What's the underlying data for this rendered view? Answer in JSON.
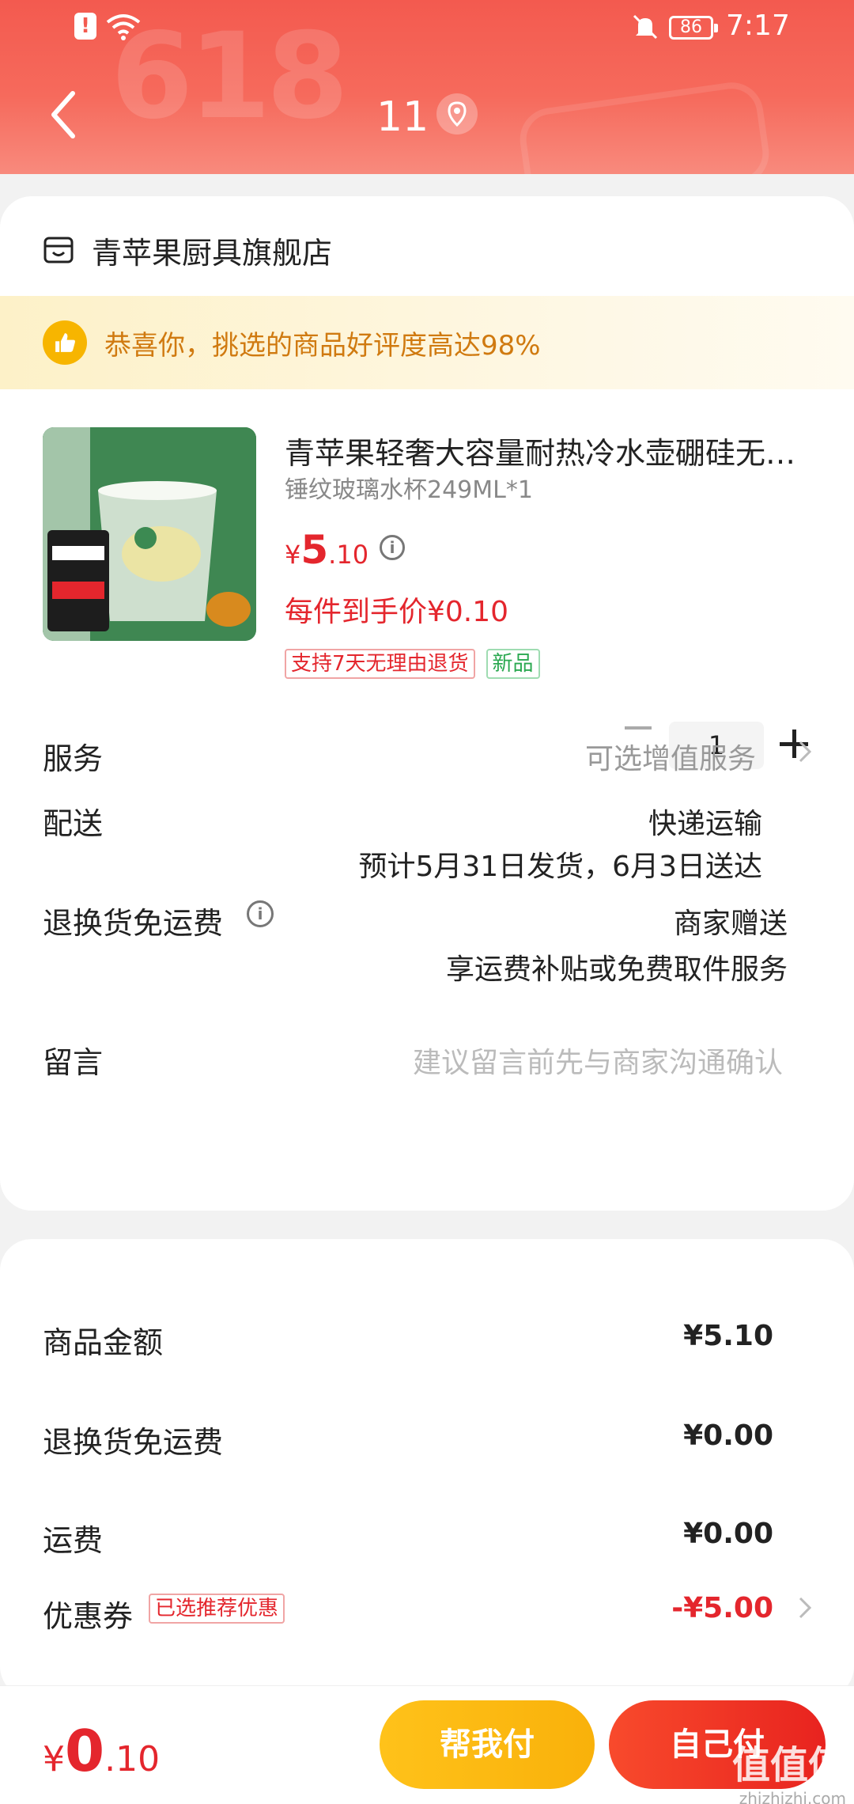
{
  "status_bar": {
    "alert": "!",
    "battery": "86",
    "time": "7:17"
  },
  "header": {
    "title": "11",
    "deco_text": "618"
  },
  "store": {
    "name": "青苹果厨具旗舰店"
  },
  "praise": {
    "text": "恭喜你，挑选的商品好评度高达98%"
  },
  "product": {
    "title": "青苹果轻奢大容量耐热冷水壶硼硅无…",
    "spec": "锤纹玻璃水杯249ML*1",
    "price_symbol": "¥",
    "price_int": "5",
    "price_dec": ".10",
    "unit_price": "每件到手价¥0.10",
    "quantity": "1",
    "tags": [
      "支持7天无理由退货",
      "新品"
    ]
  },
  "rows": {
    "service_label": "服务",
    "service_value": "可选增值服务",
    "delivery_label": "配送",
    "delivery_value1": "快递运输",
    "delivery_value2": "预计5月31日发货，6月3日送达",
    "return_label": "退换货免运费",
    "return_value1": "商家赠送",
    "return_value2": "享运费补贴或免费取件服务",
    "message_label": "留言",
    "message_placeholder": "建议留言前先与商家沟通确认"
  },
  "summary": {
    "goods_label": "商品金额",
    "goods_value": "¥5.10",
    "return_label": "退换货免运费",
    "return_value": "¥0.00",
    "shipping_label": "运费",
    "shipping_value": "¥0.00",
    "coupon_label": "优惠券",
    "coupon_tag": "已选推荐优惠",
    "coupon_value": "-¥5.00"
  },
  "bottom": {
    "total_symbol": "¥",
    "total_int": "0",
    "total_dec": ".10",
    "help_pay": "帮我付",
    "self_pay": "自己付",
    "watermark": "值值值",
    "watermark_url": "zhizhizhi.com"
  },
  "colors": {
    "accent_red": "#e4262d",
    "header_red": "#f35a4f",
    "help_yellow": "#ffc21a"
  }
}
